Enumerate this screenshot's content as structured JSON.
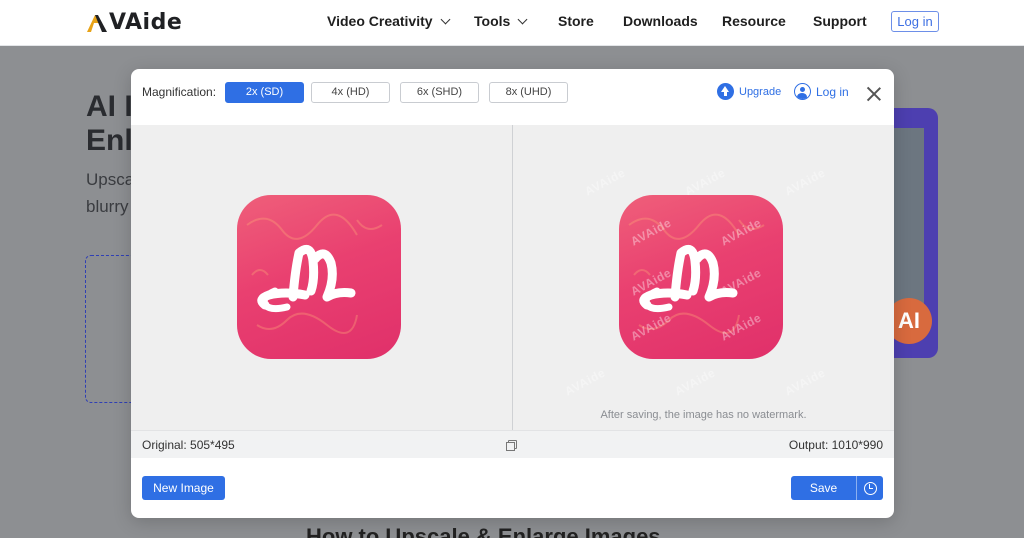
{
  "nav": {
    "logo_text": "VAide",
    "items": [
      {
        "label": "Video Creativity",
        "has_dropdown": true
      },
      {
        "label": "Tools",
        "has_dropdown": true
      },
      {
        "label": "Store",
        "has_dropdown": false
      },
      {
        "label": "Downloads",
        "has_dropdown": false
      },
      {
        "label": "Resource",
        "has_dropdown": false
      },
      {
        "label": "Support",
        "has_dropdown": false
      }
    ],
    "login_label": "Log in"
  },
  "background": {
    "heading_line1": "AI I",
    "heading_line2": "Enl",
    "text_line1": "Upsca",
    "text_line2": "blurry",
    "right_badge": "AI",
    "bottom_title": "How to Upscale & Enlarge Images"
  },
  "modal": {
    "magnification_label": "Magnification:",
    "magnification_options": [
      {
        "label": "2x (SD)",
        "selected": true
      },
      {
        "label": "4x (HD)",
        "selected": false
      },
      {
        "label": "6x (SHD)",
        "selected": false
      },
      {
        "label": "8x (UHD)",
        "selected": false
      }
    ],
    "upgrade_label": "Upgrade",
    "login_label": "Log in",
    "watermark_text": "AVAide",
    "watermark_notice": "After saving, the image has no watermark.",
    "original_info": "Original: 505*495",
    "output_info": "Output: 1010*990",
    "new_image_label": "New Image",
    "save_label": "Save"
  },
  "colors": {
    "accent": "#2f6fe4",
    "icon_pink": "#e94070",
    "logo_gold": "#e8a317"
  }
}
